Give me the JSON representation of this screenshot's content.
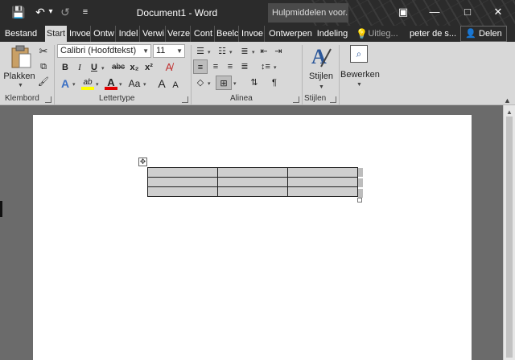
{
  "window": {
    "title": "Document1 - Word",
    "help_search": "Hulpmiddelen voor...",
    "minimize": "—",
    "restore": "▢",
    "maximize": "□",
    "close": "✕",
    "ribbon_toggle": "▣"
  },
  "quick_access": {
    "save": "💾",
    "undo": "↶",
    "undo_dropdown": "▾",
    "redo": "↺",
    "customize": "≡"
  },
  "tabs": [
    {
      "label": "Bestand"
    },
    {
      "label": "Start"
    },
    {
      "label": "Invoe"
    },
    {
      "label": "Ontw"
    },
    {
      "label": "Indel"
    },
    {
      "label": "Verwi"
    },
    {
      "label": "Verze"
    },
    {
      "label": "Cont"
    },
    {
      "label": "Beelc"
    },
    {
      "label": "Invoe"
    },
    {
      "label": "Ontwerpen"
    },
    {
      "label": "Indeling"
    }
  ],
  "tell_me": "Uitleg...",
  "user": "peter de s...",
  "share": "Delen",
  "clipboard": {
    "paste": "Plakken",
    "group": "Klembord"
  },
  "font": {
    "name": "Calibri (Hoofdtekst)",
    "size": "11",
    "bold": "B",
    "italic": "I",
    "underline": "U",
    "strike": "abc",
    "subscript": "x₂",
    "superscript": "x²",
    "text_effects": "A",
    "highlight": "ab",
    "font_color": "A",
    "change_case": "Aa",
    "grow": "A",
    "shrink": "A",
    "group": "Lettertype"
  },
  "paragraph": {
    "group": "Alinea",
    "pilcrow": "¶"
  },
  "styles": {
    "label": "Stijlen",
    "group": "Stijlen"
  },
  "editing": {
    "label": "Bewerken"
  },
  "colors": {
    "titlebar": "#2b2b2b",
    "ribbon": "#d8d8d8",
    "highlight": "#ffff00",
    "font_color": "#e00000",
    "accent_blue": "#2b579a"
  },
  "table": {
    "rows": 3,
    "cols": 3,
    "move_handle": "✥"
  }
}
